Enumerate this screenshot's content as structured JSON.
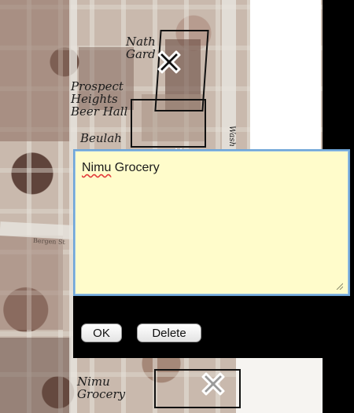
{
  "map": {
    "labels": {
      "nath": "Nath Gard",
      "prospect": "Prospect Heights Beer Hall",
      "beulah": "Beulah",
      "nimu": "Nimu Grocery",
      "side": "Wash",
      "street": "Bergen St"
    },
    "markers": [
      "close-icon",
      "close-icon"
    ]
  },
  "note_dialog": {
    "text": "Grocery",
    "text_misspelled": "Nimu",
    "ok_label": "OK",
    "delete_label": "Delete"
  },
  "colors": {
    "note_background": "#fffccb",
    "note_border": "#6fa6d8",
    "dialog_background": "#000000"
  }
}
